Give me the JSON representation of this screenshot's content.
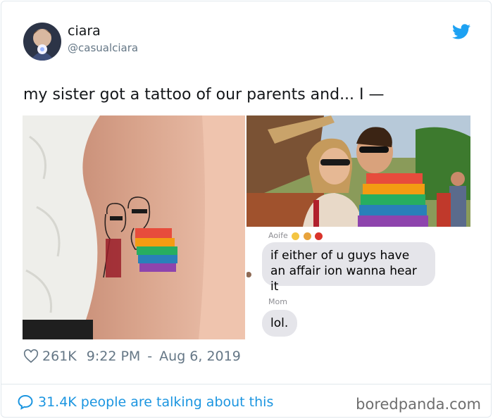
{
  "tweet": {
    "author_name": "ciara",
    "author_handle": "@casualciara",
    "text": "my sister got a tattoo of our parents and... I —",
    "likes": "261K",
    "time": "9:22 PM",
    "date_separator": "-",
    "date": "Aug 6, 2019",
    "conversation": "31.4K people are talking about this"
  },
  "chat": {
    "sender": "Aoife",
    "message1": "if either of u guys have an affair ion wanna hear it",
    "sender2": "Mom",
    "message2": "lol."
  },
  "icons": {
    "brand": "twitter-bird-icon",
    "like": "heart-icon",
    "reply": "speech-bubble-icon"
  },
  "colors": {
    "twitter_blue": "#1da1f2",
    "link_blue": "#1b95e0",
    "secondary_text": "#657786",
    "imessage_gray": "#e5e5ea"
  },
  "watermark": "boredpanda.com"
}
